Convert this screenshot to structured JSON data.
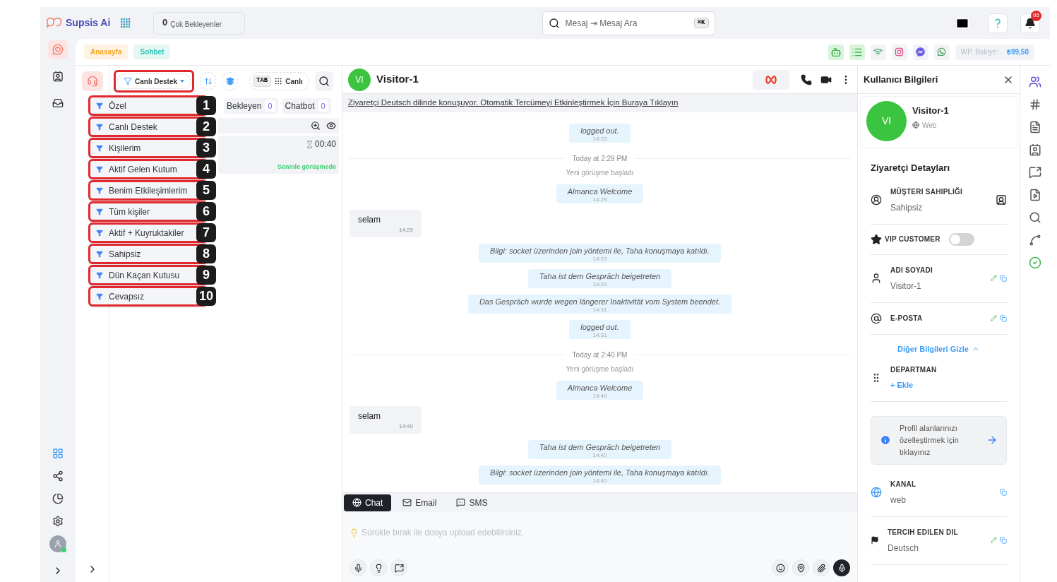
{
  "brand": {
    "name": "Supsis Ai"
  },
  "waiting": {
    "count": "0",
    "label": "Çok Bekleyenler"
  },
  "search": {
    "value": "Mesaj ⇥ Mesaj Ara",
    "shortcut": "⌘K"
  },
  "notifications": {
    "count": "95"
  },
  "nav_rail": [
    {
      "kind": "chat",
      "selected": true
    },
    {
      "kind": "contacts",
      "selected": false
    },
    {
      "kind": "inbox",
      "selected": false
    }
  ],
  "page_tabs": [
    {
      "label": "Anasayfa",
      "color": "#f5a623"
    },
    {
      "label": "Sohbet",
      "color": "#2ec4b6"
    }
  ],
  "balance": {
    "label": "WP. Bakiye:",
    "amount": "₺99,50"
  },
  "list_panel": {
    "filter": "Canlı Destek",
    "view_key": "TAB",
    "view_label": "Canlı",
    "counters": [
      {
        "label": "Bekleyen",
        "count": "0"
      },
      {
        "label": "Chatbot",
        "count": "0"
      }
    ],
    "conversation": {
      "timer": "00:40",
      "status": "Seninle görüşmede"
    }
  },
  "filter_menu": [
    {
      "label": "Özel",
      "step": "1"
    },
    {
      "label": "Canlı Destek",
      "step": "2"
    },
    {
      "label": "Kişilerim",
      "step": "3"
    },
    {
      "label": "Aktif Gelen Kutum",
      "step": "4"
    },
    {
      "label": "Benim Etkileşimlerim",
      "step": "5"
    },
    {
      "label": "Tüm kişiler",
      "step": "6"
    },
    {
      "label": "Aktif + Kuyruktakiler",
      "step": "7"
    },
    {
      "label": "Sahipsiz",
      "step": "8"
    },
    {
      "label": "Dün Kaçan Kutusu",
      "step": "9"
    },
    {
      "label": "Cevapsız",
      "step": "10"
    }
  ],
  "chat": {
    "initials": "VI",
    "name": "Visitor-1",
    "translate_banner": "Ziyaretçi Deutsch dilinde konuşuyor. Otomatik Tercümeyi Etkinleştirmek İçin Buraya Tıklayın",
    "messages": [
      {
        "kind": "system",
        "text": "logged out.",
        "time": "14:25"
      },
      {
        "kind": "divider",
        "text": "Today at 2:29 PM"
      },
      {
        "kind": "notice",
        "text": "Yeni görüşme başladı"
      },
      {
        "kind": "system",
        "text": "Almanca Welcome",
        "time": "14:29"
      },
      {
        "kind": "visitor",
        "text": "selam",
        "time": "14:29"
      },
      {
        "kind": "system",
        "text": "Bilgi: socket üzerinden join yöntemi ile, Taha konuşmaya katıldı.",
        "time": "14:29"
      },
      {
        "kind": "system",
        "text": "Taha ist dem Gespräch beigetreten",
        "time": "14:29"
      },
      {
        "kind": "system",
        "text": "Das Gespräch wurde wegen längerer Inaktivität vom System beendet.",
        "time": "14:31"
      },
      {
        "kind": "system",
        "text": "logged out.",
        "time": "14:31"
      },
      {
        "kind": "divider",
        "text": "Today at 2:40 PM"
      },
      {
        "kind": "notice",
        "text": "Yeni görüşme başladı"
      },
      {
        "kind": "system",
        "text": "Almanca Welcome",
        "time": "14:40"
      },
      {
        "kind": "visitor",
        "text": "selam",
        "time": "14:40"
      },
      {
        "kind": "system",
        "text": "Taha ist dem Gespräch beigetreten",
        "time": "14:40"
      },
      {
        "kind": "system",
        "text": "Bilgi: socket üzerinden join yöntemi ile, Taha konuşmaya katıldı.",
        "time": "14:40"
      }
    ],
    "composer_tabs": [
      {
        "kind": "chat",
        "label": "Chat",
        "selected": true
      },
      {
        "kind": "email",
        "label": "Email",
        "selected": false
      },
      {
        "kind": "sms",
        "label": "SMS",
        "selected": false
      }
    ],
    "composer": {
      "placeholder": "Sürükle bırak ile dosya upload edebilirsiniz."
    }
  },
  "user_info": {
    "title": "Kullanıcı Bilgileri",
    "initials": "VI",
    "name": "Visitor-1",
    "source": "Web",
    "section": "Ziyaretçi Detayları",
    "fields": [
      {
        "kind": "owner",
        "label": "MÜŞTERI SAHIPLIĞI",
        "value": "Sahipsiz"
      },
      {
        "kind": "toggle",
        "label": "VIP CUSTOMER",
        "on": false
      },
      {
        "kind": "name",
        "label": "ADI SOYADI",
        "value": "Visitor-1",
        "editable": true
      },
      {
        "kind": "email",
        "label": "E-POSTA",
        "editable": true
      },
      {
        "kind": "more",
        "label": "Diğer Bilgileri Gizle"
      },
      {
        "kind": "department",
        "label": "DEPARTMAN",
        "value": "+ Ekle"
      },
      {
        "kind": "hint",
        "label": "Profil alanlarınızı özelleştirmek için tıklayınız"
      },
      {
        "kind": "channel",
        "label": "KANAL",
        "value": "web",
        "editable": false
      },
      {
        "kind": "language",
        "label": "TERCIH EDILEN DIL",
        "value": "Deutsch",
        "editable": true
      }
    ]
  }
}
